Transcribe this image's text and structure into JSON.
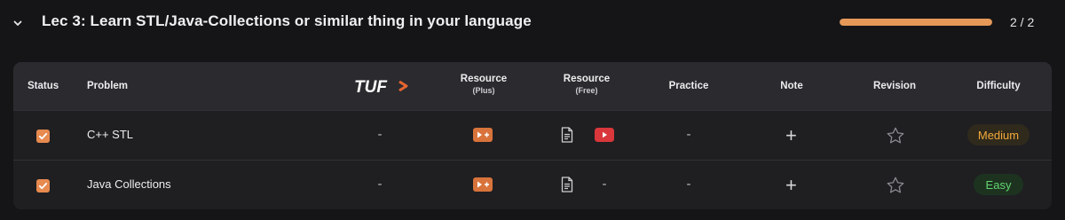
{
  "section": {
    "title": "Lec 3: Learn STL/Java-Collections or similar thing in your language",
    "progress_text": "2 / 2",
    "progress_fraction": 1.0,
    "accent_color": "#e59858"
  },
  "table": {
    "headers": {
      "status": "Status",
      "problem": "Problem",
      "tuf": "TUF",
      "resource_plus": "Resource",
      "resource_plus_sub": "(Plus)",
      "resource_free": "Resource",
      "resource_free_sub": "(Free)",
      "practice": "Practice",
      "note": "Note",
      "revision": "Revision",
      "difficulty": "Difficulty"
    },
    "rows": [
      {
        "problem": "C++ STL",
        "checked": true,
        "tuf": "-",
        "resource_plus_icon": "play-plus-icon",
        "resource_free": [
          "article-icon",
          "youtube-icon"
        ],
        "practice": "-",
        "note": "+",
        "revision_icon": "star-outline-icon",
        "difficulty": "Medium"
      },
      {
        "problem": "Java Collections",
        "checked": true,
        "tuf": "-",
        "resource_plus_icon": "play-plus-icon",
        "resource_free": [
          "article-icon"
        ],
        "resource_free_dash": "-",
        "practice": "-",
        "note": "+",
        "revision_icon": "star-outline-icon",
        "difficulty": "Easy"
      }
    ]
  },
  "colors": {
    "checkbox": "#e78a4f",
    "medium": "#f2a93b",
    "easy": "#63d471",
    "youtube": "#d9373b"
  }
}
